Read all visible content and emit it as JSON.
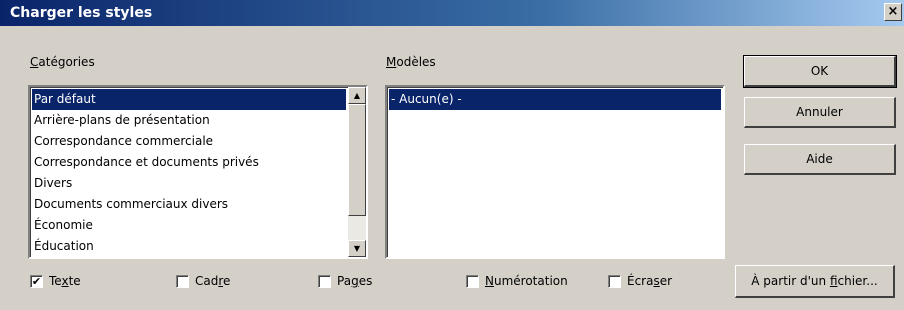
{
  "window": {
    "title": "Charger les styles",
    "close_glyph": "×"
  },
  "categories": {
    "label_underlined": "C",
    "label_rest": "atégories",
    "items": [
      "Par défaut",
      "Arrière-plans de présentation",
      "Correspondance commerciale",
      "Correspondance et documents privés",
      "Divers",
      "Documents commerciaux divers",
      "Économie",
      "Éducation"
    ],
    "selected_index": 0
  },
  "models": {
    "label_underlined": "M",
    "label_rest": "odèles",
    "items": [
      "- Aucun(e) -"
    ],
    "selected_index": 0
  },
  "buttons": {
    "ok": "OK",
    "cancel": "Annuler",
    "help": "Aide",
    "from_file_prefix": "À partir d'un ",
    "from_file_underlined": "f",
    "from_file_rest": "ichier..."
  },
  "checkboxes": [
    {
      "pre": "Te",
      "u": "x",
      "post": "te",
      "checked": true
    },
    {
      "pre": "Cad",
      "u": "r",
      "post": "e",
      "checked": false
    },
    {
      "pre": "Pa",
      "u": "g",
      "post": "es",
      "checked": false
    },
    {
      "pre": "",
      "u": "N",
      "post": "umérotation",
      "checked": false
    },
    {
      "pre": "Écra",
      "u": "s",
      "post": "er",
      "checked": false
    }
  ],
  "icons": {
    "scroll_up": "▲",
    "scroll_down": "▼",
    "check_mark": "✔"
  }
}
